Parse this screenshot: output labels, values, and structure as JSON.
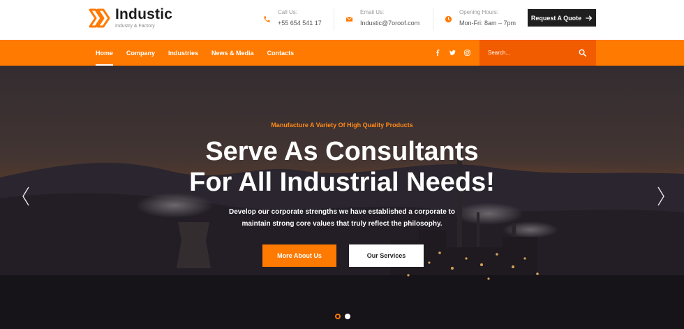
{
  "brand": {
    "name": "Industic",
    "tagline": "Industry & Factory",
    "logo_icon": "double-chevron-logo-icon",
    "accent_color": "#ff7a00"
  },
  "contact": {
    "call": {
      "label": "Call Us:",
      "value": "+55 654 541 17",
      "icon": "phone-icon"
    },
    "email": {
      "label": "Email Us:",
      "value": "Industic@7oroof.com",
      "icon": "envelope-icon"
    },
    "hours": {
      "label": "Opening Hours:",
      "value": "Mon-Fri: 8am – 7pm",
      "icon": "clock-icon"
    }
  },
  "quote_button": {
    "label": "Request A Quote",
    "icon": "arrow-right-icon"
  },
  "nav": {
    "items": [
      {
        "label": "Home",
        "active": true
      },
      {
        "label": "Company",
        "active": false
      },
      {
        "label": "Industries",
        "active": false
      },
      {
        "label": "News & Media",
        "active": false
      },
      {
        "label": "Contacts",
        "active": false
      }
    ],
    "social": [
      "facebook-icon",
      "twitter-icon",
      "instagram-icon"
    ],
    "search": {
      "placeholder": "Search...",
      "icon": "search-icon"
    }
  },
  "hero": {
    "kicker": "Manufacture A Variety Of High Quality Products",
    "title_line1": "Serve As Consultants",
    "title_line2": "For All Industrial Needs!",
    "desc_line1": "Develop our corporate strengths we have established a corporate to",
    "desc_line2": "maintain strong core values that truly reflect the philosophy.",
    "primary_button": "More About Us",
    "secondary_button": "Our Services",
    "slides": {
      "count": 2,
      "active": 1
    }
  }
}
